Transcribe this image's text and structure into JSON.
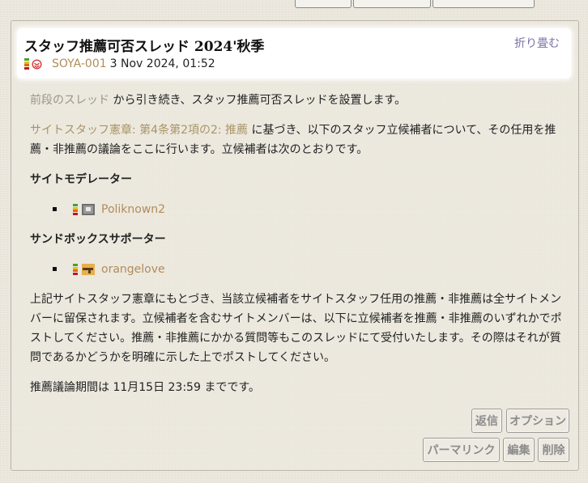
{
  "post": {
    "title": "スタッフ推薦可否スレッド 2024'秋季",
    "fold_label": "折り畳む",
    "author": "SOYA-001",
    "date": "3 Nov 2024, 01:52"
  },
  "content": {
    "intro_link": "前段のスレッド",
    "intro_text": " から引き続き、スタッフ推薦可否スレッドを設置します。",
    "charter_link": "サイトスタッフ憲章: 第4条第2項の2: 推薦",
    "charter_text": " に基づき、以下のスタッフ立候補者について、その任用を推薦・非推薦の議論をここに行います。立候補者は次のとおりです。",
    "section_moderator": "サイトモデレーター",
    "moderator_candidate": "Poliknown2",
    "section_sandbox": "サンドボックスサポーター",
    "sandbox_candidate": "orangelove",
    "body_text": "上記サイトスタッフ憲章にもとづき、当該立候補者をサイトスタッフ任用の推薦・非推薦は全サイトメンバーに留保されます。立候補者を含むサイトメンバーは、以下に立候補者を推薦・非推薦のいずれかでポストしてください。推薦・非推薦にかかる質問等もこのスレッドにて受付いたします。その際はそれが質問であるかどうかを明確に示した上でポストしてください。",
    "period_text": "推薦議論期間は 11月15日 23:59 までです。"
  },
  "actions": {
    "reply": "返信",
    "options": "オプション",
    "permalink": "パーマリンク",
    "edit": "編集",
    "delete": "削除"
  },
  "colors": {
    "background": "#ede9df",
    "link_purple": "#7b74a6",
    "user_link": "#b08d5b",
    "charter_link": "#a89566",
    "button_text": "#8c8c8c"
  }
}
